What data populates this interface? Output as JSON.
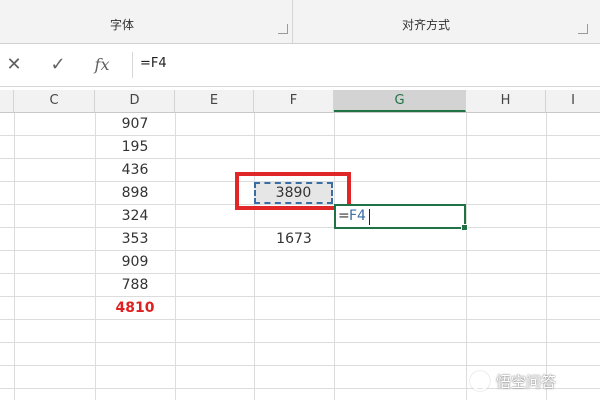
{
  "ribbon": {
    "groups": [
      {
        "label": "字体"
      },
      {
        "label": "对齐方式"
      }
    ]
  },
  "formula_bar": {
    "cancel_icon": "close-icon",
    "enter_icon": "check-icon",
    "function_label": "fx",
    "value": "=F4"
  },
  "columns": [
    "C",
    "D",
    "E",
    "F",
    "G",
    "H",
    "I"
  ],
  "active_column": "G",
  "column_d_values": [
    "907",
    "195",
    "436",
    "898",
    "324",
    "353",
    "909",
    "788"
  ],
  "column_d_total": "4810",
  "copied_cell_value": "3890",
  "f6_value": "1673",
  "editing": {
    "equals": "=",
    "reference": "F4"
  },
  "colors": {
    "accent_green": "#217346",
    "highlight_red": "#e02626",
    "total_red": "#e02020",
    "reference_blue": "#3a6ea5"
  },
  "watermark": {
    "text": "悟空问答"
  }
}
